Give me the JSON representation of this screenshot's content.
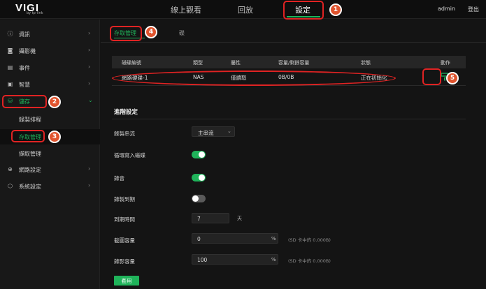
{
  "header": {
    "logo": "VIGI",
    "logo_sub": "by tp-link",
    "tabs": [
      {
        "label": "線上觀看"
      },
      {
        "label": "回放"
      },
      {
        "label": "設定"
      }
    ],
    "user": "admin",
    "logout": "登出"
  },
  "sidebar": {
    "items": [
      {
        "label": "資訊",
        "icon": "info-icon"
      },
      {
        "label": "攝影機",
        "icon": "camera-icon"
      },
      {
        "label": "事件",
        "icon": "event-icon"
      },
      {
        "label": "智慧",
        "icon": "smart-icon"
      },
      {
        "label": "儲存",
        "icon": "storage-icon"
      },
      {
        "label": "錄製排程"
      },
      {
        "label": "存取管理"
      },
      {
        "label": "擷取管理"
      },
      {
        "label": "網路設定",
        "icon": "globe-icon"
      },
      {
        "label": "系統設定",
        "icon": "settings-icon"
      }
    ]
  },
  "main": {
    "subtabs": [
      "存取管理",
      "碟"
    ],
    "table": {
      "headers": [
        "磁碟編號",
        "類型",
        "屬性",
        "容量/剩餘容量",
        "狀態",
        "動作"
      ],
      "rows": [
        {
          "name": "網路硬碟-1",
          "type": "NAS",
          "attr": "僅讀取",
          "capacity": "0B/0B",
          "status": "正在初始化"
        }
      ]
    },
    "advanced": {
      "title": "進階設定",
      "record_stream_label": "錄製串流",
      "record_stream_value": "主串流",
      "loop_write_label": "循環寫入磁碟",
      "audio_label": "錄音",
      "expire_label": "錄製到期",
      "expire_time_label": "到期時間",
      "expire_time_value": "7",
      "expire_unit": "天",
      "snapshot_label": "截圖容量",
      "snapshot_value": "0",
      "snapshot_unit": "%",
      "snapshot_hint": "(SD 卡中的 0.000B)",
      "video_label": "錄影容量",
      "video_value": "100",
      "video_unit": "%",
      "video_hint": "(SD 卡中的 0.000B)",
      "apply": "套用"
    }
  },
  "annotations": [
    "1",
    "2",
    "3",
    "4",
    "5"
  ],
  "colors": {
    "accent": "#1fb35a",
    "annotation": "#e02323"
  }
}
